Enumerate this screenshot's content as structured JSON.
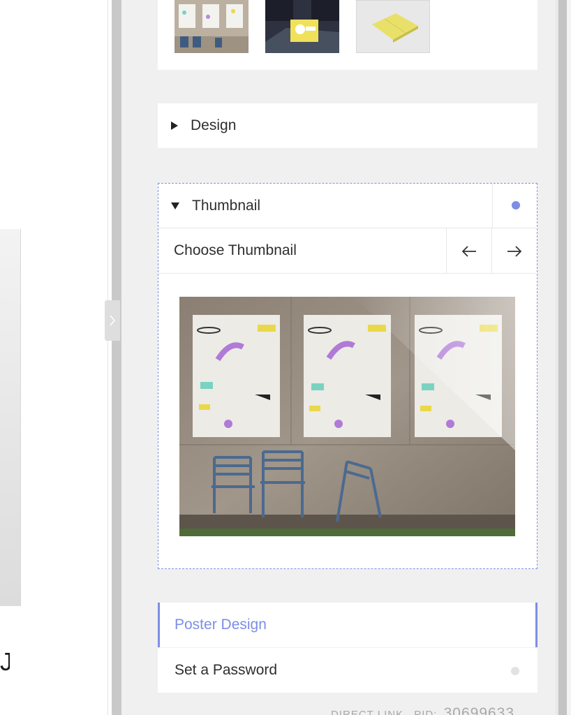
{
  "sections": {
    "design": {
      "label": "Design",
      "expanded": false
    },
    "thumbnail": {
      "label": "Thumbnail",
      "expanded": true,
      "choose_label": "Choose Thumbnail",
      "prev_icon": "arrow-left-icon",
      "next_icon": "arrow-right-icon"
    }
  },
  "items": {
    "poster_design": {
      "label": "Poster Design",
      "active": true
    },
    "set_password": {
      "label": "Set a Password"
    }
  },
  "footer": {
    "direct_link": "DIRECT LINK",
    "pid_label": "PID:",
    "pid_value": "30699633"
  },
  "preview": {
    "glyph": "J"
  },
  "colors": {
    "accent": "#7c8ee6",
    "panel_bg": "#f0f0f0",
    "card_bg": "#ffffff",
    "inactive_dot": "#e2e2e2"
  }
}
